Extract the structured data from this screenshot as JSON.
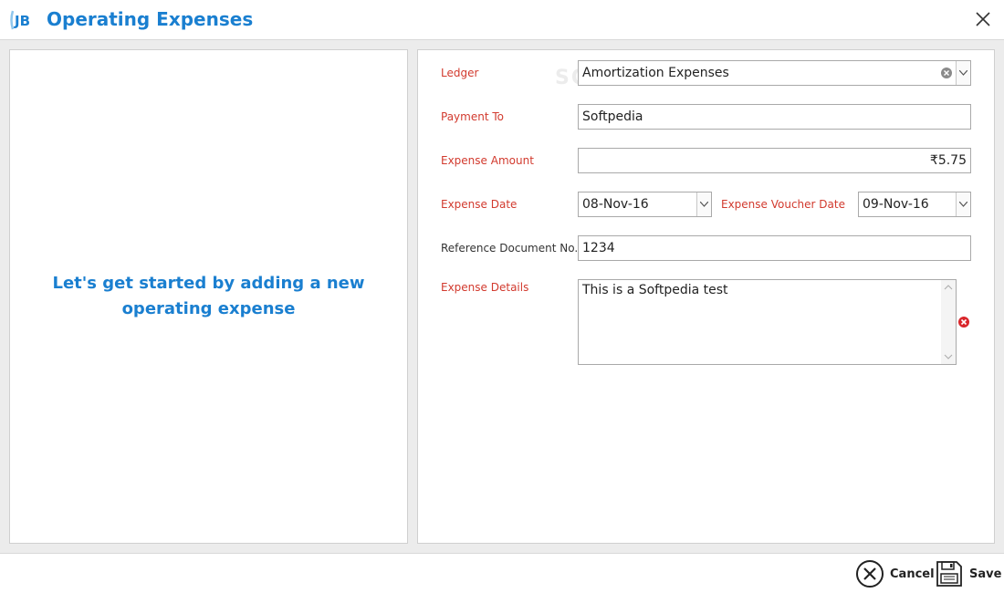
{
  "window": {
    "title": "Operating Expenses",
    "logo_text": "JB",
    "watermark": "SOFTPEDIA"
  },
  "left_panel": {
    "message": "Let's get started by adding a new\noperating expense"
  },
  "form": {
    "ledger": {
      "label": "Ledger",
      "value": "Amortization Expenses"
    },
    "payment_to": {
      "label": "Payment To",
      "value": "Softpedia"
    },
    "expense_amount": {
      "label": "Expense Amount",
      "value": "₹5.75"
    },
    "expense_date": {
      "label": "Expense Date",
      "value": "08-Nov-16"
    },
    "expense_voucher_date": {
      "label": "Expense Voucher Date",
      "value": "09-Nov-16"
    },
    "reference_document": {
      "label": "Reference Document No.",
      "value": "1234"
    },
    "expense_details": {
      "label": "Expense Details",
      "value": "This is a Softpedia test"
    }
  },
  "footer": {
    "cancel_label": "Cancel",
    "save_label": "Save"
  },
  "colors": {
    "accent": "#1a7fd0",
    "required_label": "#d23a2e",
    "error": "#d9262b"
  }
}
